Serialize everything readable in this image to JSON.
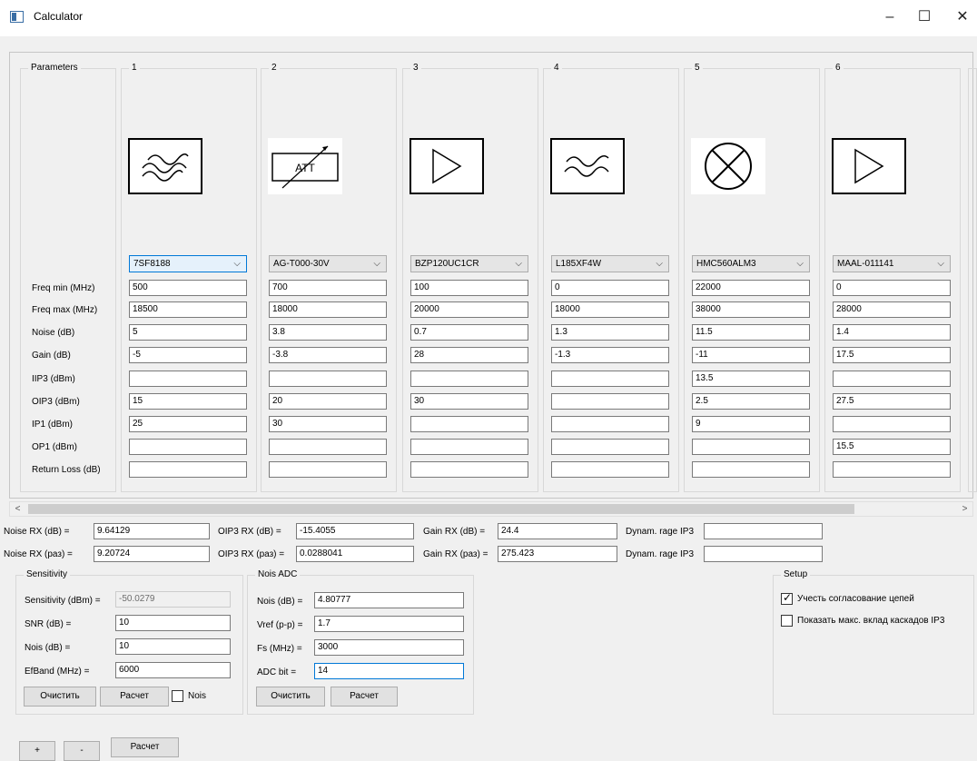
{
  "window": {
    "title": "Calculator",
    "minimize": "–",
    "maximize": "☐",
    "close": "✕"
  },
  "param_group_title": "Parameters",
  "param_labels": [
    "Freq min (MHz)",
    "Freq max (MHz)",
    "Noise (dB)",
    "Gain (dB)",
    "IIP3 (dBm)",
    "OIP3 (dBm)",
    "IP1 (dBm)",
    "OP1 (dBm)",
    "Return Loss (dB)"
  ],
  "stages": [
    {
      "num": "1",
      "icon": "filter-icon",
      "component": "7SF8188",
      "values": [
        "500",
        "18500",
        "5",
        "-5",
        "",
        "15",
        "25",
        "",
        ""
      ]
    },
    {
      "num": "2",
      "icon": "attenuator-icon",
      "symbol_text": "ATT",
      "component": "AG-T000-30V",
      "values": [
        "700",
        "18000",
        "3.8",
        "-3.8",
        "",
        "20",
        "30",
        "",
        ""
      ]
    },
    {
      "num": "3",
      "icon": "amplifier-icon",
      "component": "BZP120UC1CR",
      "values": [
        "100",
        "20000",
        "0.7",
        "28",
        "",
        "30",
        "",
        "",
        ""
      ]
    },
    {
      "num": "4",
      "icon": "lowpass-filter-icon",
      "component": "L185XF4W",
      "values": [
        "0",
        "18000",
        "1.3",
        "-1.3",
        "",
        "",
        "",
        "",
        ""
      ]
    },
    {
      "num": "5",
      "icon": "mixer-icon",
      "component": "HMC560ALM3",
      "values": [
        "22000",
        "38000",
        "11.5",
        "-11",
        "13.5",
        "2.5",
        "9",
        "",
        ""
      ]
    },
    {
      "num": "6",
      "icon": "amplifier-icon",
      "component": "MAAL-011141",
      "values": [
        "0",
        "28000",
        "1.4",
        "17.5",
        "",
        "27.5",
        "",
        "15.5",
        ""
      ]
    }
  ],
  "results": {
    "noise_rx_db_label": "Noise RX (dB) =",
    "noise_rx_db": "9.64129",
    "oip3_rx_db_label": "OIP3 RX (dB) =",
    "oip3_rx_db": "-15.4055",
    "gain_rx_db_label": "Gain RX (dB) =",
    "gain_rx_db": "24.4",
    "dynam_label_1": "Dynam. rage IP3",
    "dynam_value_1": "",
    "noise_rx_raz_label": "Noise RX (раз) =",
    "noise_rx_raz": "9.20724",
    "oip3_rx_raz_label": "OIP3 RX (раз) =",
    "oip3_rx_raz": "0.0288041",
    "gain_rx_raz_label": "Gain RX (раз) =",
    "gain_rx_raz": "275.423",
    "dynam_label_2": "Dynam. rage IP3",
    "dynam_value_2": ""
  },
  "sensitivity": {
    "title": "Sensitivity",
    "sens_label": "Sensitivity (dBm) =",
    "sens_value": "-50.0279",
    "snr_label": "SNR (dB) =",
    "snr_value": "10",
    "nois_label": "Nois (dB) =",
    "nois_value": "10",
    "efband_label": "EfBand (MHz) =",
    "efband_value": "6000",
    "clear_label": "Очистить",
    "calc_label": "Расчет",
    "nois_check_label": "Nois"
  },
  "nois_adc": {
    "title": "Nois ADC",
    "nois_label": "Nois (dB) =",
    "nois_value": "4.80777",
    "vref_label": "Vref (p-p) =",
    "vref_value": "1.7",
    "fs_label": "Fs (MHz) =",
    "fs_value": "3000",
    "adcbit_label": "ADC bit =",
    "adcbit_value": "14",
    "clear_label": "Очистить",
    "calc_label": "Расчет"
  },
  "setup": {
    "title": "Setup",
    "opt1_label": "Учесть согласование цепей",
    "opt1_checked": true,
    "opt2_label": "Показать макс. вклад каскадов IP3",
    "opt2_checked": false
  },
  "bottom_buttons": {
    "plus": "+",
    "minus": "-",
    "calc": "Расчет"
  },
  "scroll_arrows": {
    "left": "<",
    "right": ">"
  }
}
